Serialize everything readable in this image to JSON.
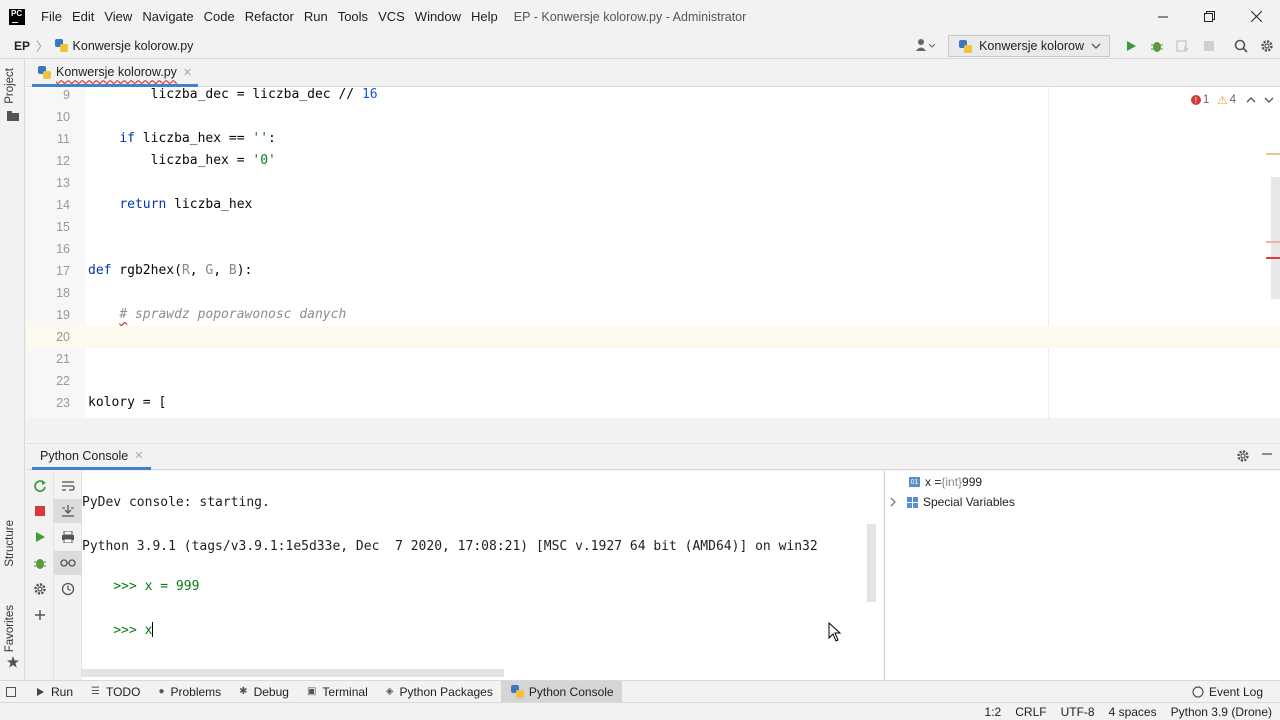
{
  "titlebar": {
    "menu": [
      "File",
      "Edit",
      "View",
      "Navigate",
      "Code",
      "Refactor",
      "Run",
      "Tools",
      "VCS",
      "Window",
      "Help"
    ],
    "window_title": "EP - Konwersje kolorow.py - Administrator"
  },
  "navbar": {
    "project": "EP",
    "file": "Konwersje kolorow.py",
    "run_config": "Konwersje kolorow"
  },
  "left_strip": {
    "project_label": "Project",
    "structure_label": "Structure",
    "favorites_label": "Favorites"
  },
  "editor": {
    "tab_label": "Konwersje kolorow.py",
    "errors": "1",
    "warnings": "4",
    "lines": [
      {
        "no": "9",
        "text": "        liczba_dec = liczba_dec // 16"
      },
      {
        "no": "10",
        "text": ""
      },
      {
        "no": "11",
        "text": "    if liczba_hex == '':"
      },
      {
        "no": "12",
        "text": "        liczba_hex = '0'"
      },
      {
        "no": "13",
        "text": ""
      },
      {
        "no": "14",
        "text": "    return liczba_hex"
      },
      {
        "no": "15",
        "text": ""
      },
      {
        "no": "16",
        "text": ""
      },
      {
        "no": "17",
        "text": "def rgb2hex(R, G, B):"
      },
      {
        "no": "18",
        "text": ""
      },
      {
        "no": "19",
        "text": "    # sprawdz poporawonosc danych"
      },
      {
        "no": "20",
        "text": ""
      },
      {
        "no": "21",
        "text": ""
      },
      {
        "no": "22",
        "text": ""
      },
      {
        "no": "23",
        "text": "kolory = ["
      }
    ]
  },
  "console": {
    "tab_label": "Python Console",
    "starting": "PyDev console: starting.",
    "version": "Python 3.9.1 (tags/v3.9.1:1e5d33e, Dec  7 2020, 17:08:21) [MSC v.1927 64 bit (AMD64)] on win32",
    "prompt1": ">>> ",
    "input1": "x = 999",
    "prompt2": ">>> ",
    "input2": "x"
  },
  "variables": {
    "var_name": "x = ",
    "var_type": "{int} ",
    "var_value": "999",
    "special": "Special Variables"
  },
  "toolwindows": [
    "Run",
    "TODO",
    "Problems",
    "Debug",
    "Terminal",
    "Python Packages",
    "Python Console"
  ],
  "event_log": "Event Log",
  "status": {
    "position": "1:2",
    "line_sep": "CRLF",
    "encoding": "UTF-8",
    "indent": "4 spaces",
    "interpreter": "Python 3.9 (Drone)"
  },
  "colors": {
    "accent": "#4083c9",
    "keyword": "#0033b3",
    "string": "#067d17",
    "number": "#1750eb"
  }
}
